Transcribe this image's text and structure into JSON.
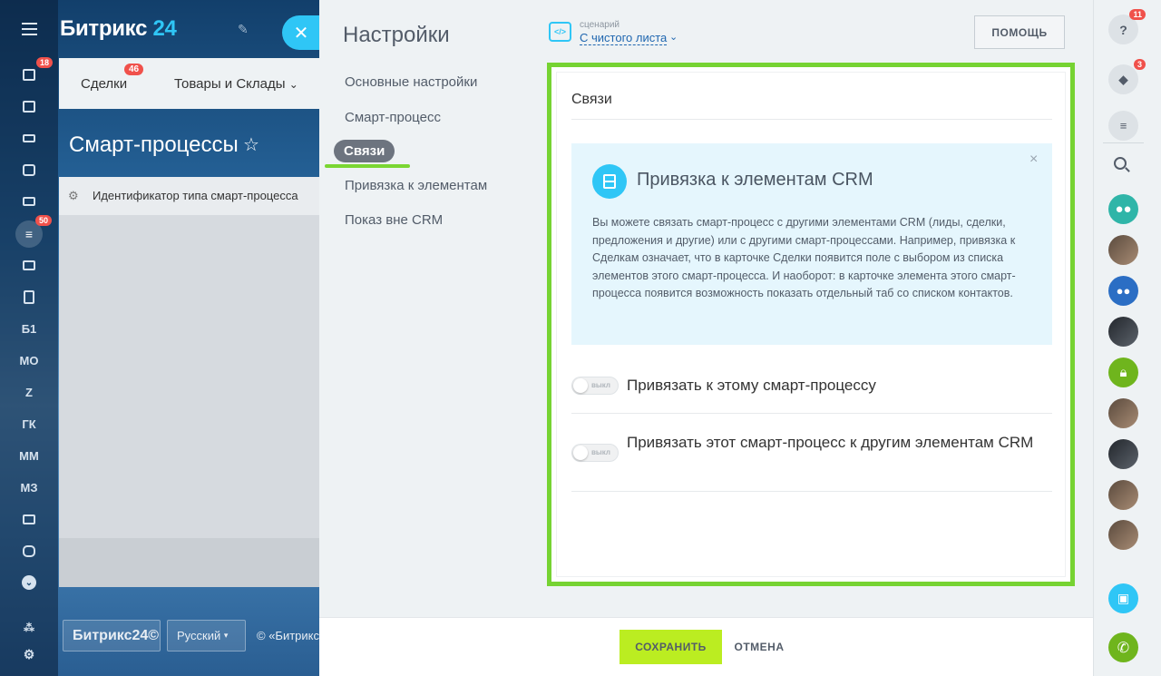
{
  "app": {
    "logo_text": "Битрикс",
    "logo_num": "24",
    "nav": [
      {
        "label": "Сделки",
        "badge": "46"
      },
      {
        "label": "Товары и Склады"
      }
    ],
    "page_title": "Смарт-процессы",
    "grid_column": "Идентификатор типа смарт-процесса",
    "left_rail": {
      "badges": {
        "tasks": "18",
        "filter": "50"
      },
      "letters": [
        "Б1",
        "МО",
        "Z",
        "ГК",
        "ММ",
        "МЗ"
      ]
    },
    "bottom": {
      "brand": "Битрикс24©",
      "language": "Русский",
      "copyright": "© «Битрикс»"
    }
  },
  "slider": {
    "title": "Настройки",
    "menu": {
      "general": "Основные настройки",
      "smart_process": "Смарт-процесс",
      "links": "Связи",
      "binding": "Привязка к элементам",
      "outside_crm": "Показ вне CRM"
    },
    "scenario": {
      "label": "сценарий",
      "value": "С чистого листа",
      "icon_text": "</>"
    },
    "help_button": "ПОМОЩЬ",
    "card": {
      "title": "Связи",
      "info": {
        "title": "Привязка к элементам CRM",
        "text": "Вы можете связать смарт-процесс с другими элементами CRM (лиды, сделки, предложения и другие) или с другими смарт-процессами. Например, привязка к Сделкам означает, что в карточке Сделки появится поле с выбором из списка элементов этого смарт-процесса. И наоборот: в карточке элемента этого смарт-процесса появится возможность показать отдельный таб со списком контактов.",
        "close": "×"
      },
      "options": [
        {
          "label": "Привязать к этому смарт-процессу",
          "toggle_text": "выкл",
          "enabled": false
        },
        {
          "label": "Привязать этот смарт-процесс к другим элементам CRM",
          "toggle_text": "выкл",
          "enabled": false
        }
      ]
    },
    "footer": {
      "save": "СОХРАНИТЬ",
      "cancel": "ОТМЕНА"
    }
  },
  "right_rail": {
    "help_badge": "11",
    "notifications_badge": "3"
  },
  "colors": {
    "accent": "#2fc6f6",
    "highlight_frame": "#76d332",
    "save_button": "#bbed21",
    "badge": "#f0514b"
  }
}
